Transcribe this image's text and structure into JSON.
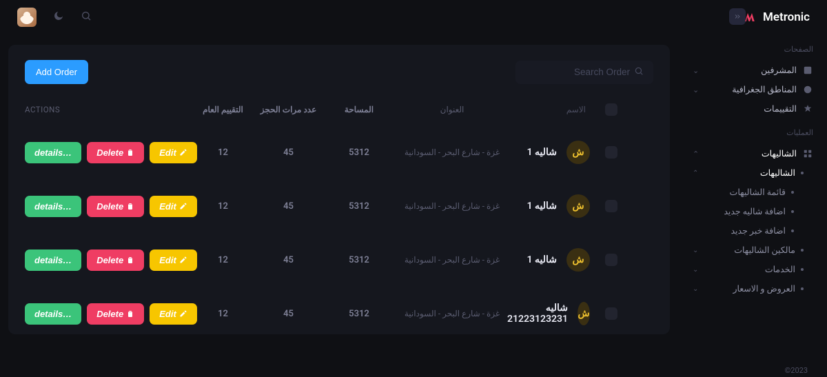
{
  "brand": {
    "name": "Metronic"
  },
  "topbar": {
    "icons": {
      "theme": "moon-icon",
      "search": "search-icon"
    }
  },
  "sidebar": {
    "section1_title": "الصفحات",
    "section1": [
      {
        "label": "المشرفين",
        "icon": "users-icon",
        "chev": true
      },
      {
        "label": "المناطق الجغرافية",
        "icon": "globe-icon",
        "chev": true
      },
      {
        "label": "التقييمات",
        "icon": "star-icon",
        "chev": false
      }
    ],
    "section2_title": "العمليات",
    "section2_root": {
      "label": "الشاليهات",
      "icon": "grid-icon",
      "chev_up": true
    },
    "section2_sub1": {
      "label": "الشاليهات",
      "chev_up": true
    },
    "section2_leaf": [
      {
        "label": "قائمة الشاليهات"
      },
      {
        "label": "اضافة شاليه جديد"
      },
      {
        "label": "اضافة خبر جديد"
      }
    ],
    "section2_tail": [
      {
        "label": "مالكين الشاليهات"
      },
      {
        "label": "الخدمات"
      },
      {
        "label": "العروض و الاسعار"
      }
    ]
  },
  "card": {
    "add_label": "Add Order",
    "search_placeholder": "Search Order"
  },
  "table": {
    "head": {
      "actions": "ACTIONS",
      "col1": "التقييم العام",
      "col2": "عدد مرات الحجز",
      "col3": "المساحة",
      "col4": "العنوان",
      "col5": "الاسم"
    },
    "btn": {
      "details": "details…",
      "delete": "Delete",
      "edit": "Edit"
    },
    "rows": [
      {
        "c1": "12",
        "c2": "45",
        "c3": "5312",
        "addr": "غزة - شارع البحر - السودانية",
        "name": "شاليه 1",
        "badge": "ش"
      },
      {
        "c1": "12",
        "c2": "45",
        "c3": "5312",
        "addr": "غزة - شارع البحر - السودانية",
        "name": "شاليه 1",
        "badge": "ش"
      },
      {
        "c1": "12",
        "c2": "45",
        "c3": "5312",
        "addr": "غزة - شارع البحر - السودانية",
        "name": "شاليه 1",
        "badge": "ش"
      },
      {
        "c1": "12",
        "c2": "45",
        "c3": "5312",
        "addr": "غزة - شارع البحر - السودانية",
        "name": "شاليه 21223123231",
        "badge": "ش"
      }
    ]
  },
  "footer": {
    "copyright": "©2023"
  }
}
